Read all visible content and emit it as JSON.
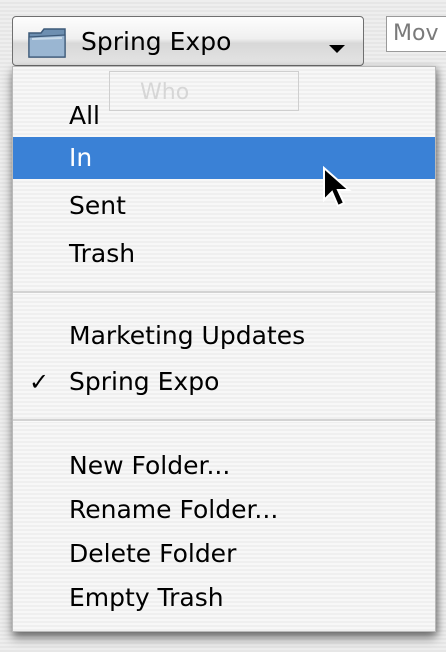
{
  "folder_popup": {
    "selected_label": "Spring Expo",
    "icon": "folder-icon"
  },
  "move_field": {
    "text": "Mov"
  },
  "ghost_column": {
    "label": "Who"
  },
  "menu": {
    "mailbox_items": [
      {
        "label": "All"
      },
      {
        "label": "In",
        "highlighted": true
      },
      {
        "label": "Sent"
      },
      {
        "label": "Trash"
      }
    ],
    "folder_items": [
      {
        "label": "Marketing Updates"
      },
      {
        "label": "Spring Expo",
        "checked": true,
        "check": "✓"
      }
    ],
    "action_items": [
      {
        "label": "New Folder..."
      },
      {
        "label": "Rename Folder..."
      },
      {
        "label": "Delete Folder"
      },
      {
        "label": "Empty Trash"
      }
    ]
  },
  "colors": {
    "highlight": "#3a81d6",
    "menu_text": "#000000",
    "highlight_text": "#ffffff"
  }
}
